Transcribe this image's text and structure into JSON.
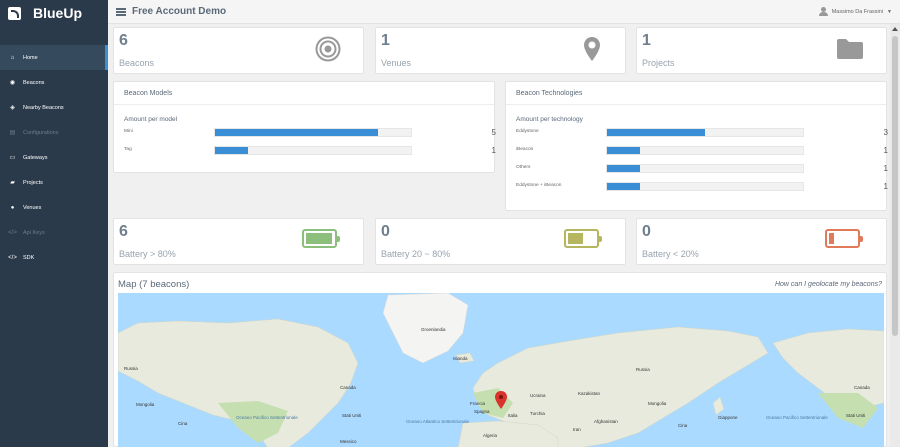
{
  "brand": {
    "name": "BlueUp"
  },
  "sidebar": {
    "items": [
      {
        "label": "Home",
        "icon": "home-icon",
        "glyph": "⌂",
        "active": true,
        "disabled": false
      },
      {
        "label": "Beacons",
        "icon": "beacon-icon",
        "glyph": "◉",
        "active": false,
        "disabled": false
      },
      {
        "label": "Nearby Beacons",
        "icon": "nearby-icon",
        "glyph": "◈",
        "active": false,
        "disabled": false
      },
      {
        "label": "Configurations",
        "icon": "config-icon",
        "glyph": "▤",
        "active": false,
        "disabled": true
      },
      {
        "label": "Gateways",
        "icon": "gateway-icon",
        "glyph": "▭",
        "active": false,
        "disabled": false
      },
      {
        "label": "Projects",
        "icon": "folder-icon",
        "glyph": "▰",
        "active": false,
        "disabled": false
      },
      {
        "label": "Venues",
        "icon": "pin-icon",
        "glyph": "●",
        "active": false,
        "disabled": false
      },
      {
        "label": "Api Keys",
        "icon": "code-icon",
        "glyph": "</>",
        "active": false,
        "disabled": true
      },
      {
        "label": "SDK",
        "icon": "sdk-icon",
        "glyph": "</>",
        "active": false,
        "disabled": false
      }
    ]
  },
  "topbar": {
    "title": "Free Account Demo",
    "user": "Massimo Da Frassini"
  },
  "stats": {
    "beacons": {
      "value": "6",
      "label": "Beacons"
    },
    "venues": {
      "value": "1",
      "label": "Venues"
    },
    "projects": {
      "value": "1",
      "label": "Projects"
    }
  },
  "models": {
    "title": "Beacon Models",
    "subtitle": "Amount per model",
    "max": 6,
    "rows": [
      {
        "label": "Mini",
        "count": 5
      },
      {
        "label": "Tag",
        "count": 1
      }
    ]
  },
  "technologies": {
    "title": "Beacon Technologies",
    "subtitle": "Amount per technology",
    "max": 6,
    "rows": [
      {
        "label": "Eddystone",
        "count": 3
      },
      {
        "label": "iBeacon",
        "count": 1
      },
      {
        "label": "Others",
        "count": 1
      },
      {
        "label": "Eddystone + iBeacon",
        "count": 1
      }
    ]
  },
  "battery": {
    "high": {
      "value": "6",
      "label": "Battery > 80%",
      "color": "#8cbf7c",
      "level": 0.95
    },
    "mid": {
      "value": "0",
      "label": "Battery 20 ~ 80%",
      "color": "#b5b65f",
      "level": 0.55
    },
    "low": {
      "value": "0",
      "label": "Battery < 20%",
      "color": "#e07a5a",
      "level": 0.2
    }
  },
  "map": {
    "title": "Map (7 beacons)",
    "help_link": "How can I geolocate my beacons?",
    "labels": {
      "greenland": "Groenlandia",
      "iceland": "Islanda",
      "canada_left": "Canada",
      "canada_right": "Canada",
      "russia_left": "Russia",
      "russia_right": "Russia",
      "mongolia_left": "Mongolia",
      "mongolia_right": "Mongolia",
      "usa_left": "Stati Uniti",
      "usa_right": "Stati Uniti",
      "china": "Cina",
      "china_right": "Cina",
      "france": "Francia",
      "italy": "Italia",
      "spain": "Spagna",
      "turkey": "Turchia",
      "ukraine": "Ucraina",
      "kazakhstan": "Kazakistan",
      "iran": "Iran",
      "afghanistan": "Afghanistan",
      "japan": "Giappone",
      "algeria": "Algeria",
      "mexico": "Messico",
      "pacific_left": "Oceano Pacifico Settentrionale",
      "pacific_right": "Oceano Pacifico Settentrionale",
      "atlantic": "Oceano Atlantico Settentrionale"
    }
  },
  "colors": {
    "sidebar": "#2b3a4a",
    "accent": "#3a8ed6",
    "marker": "#d9342b"
  }
}
